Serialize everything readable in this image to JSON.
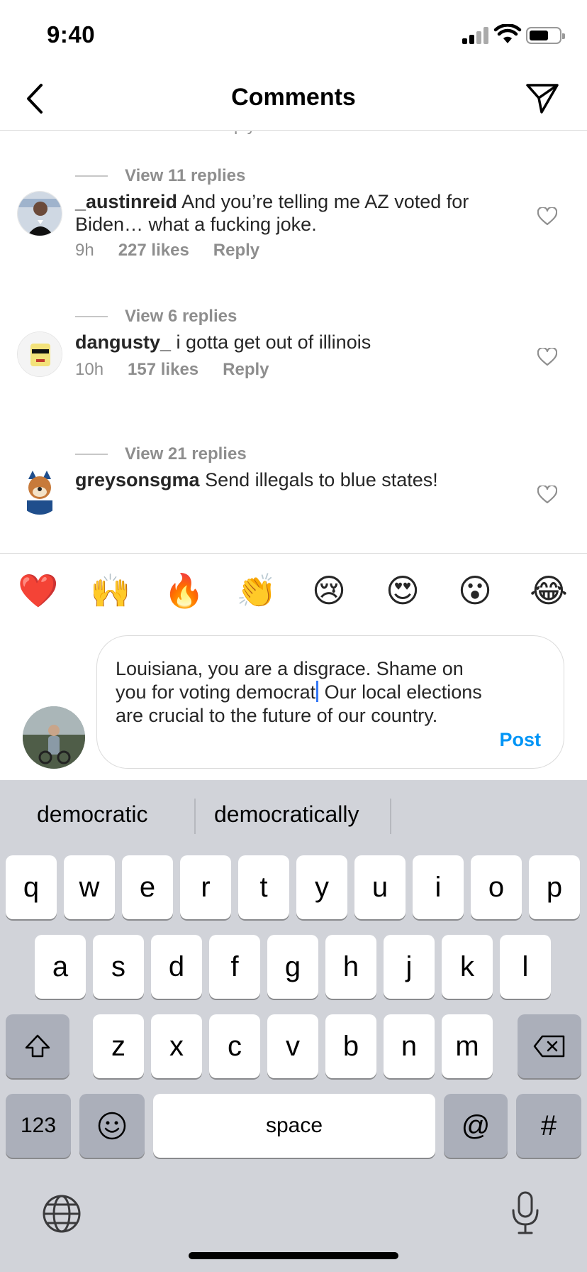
{
  "status_bar": {
    "time": "9:40"
  },
  "header": {
    "title": "Comments"
  },
  "comments": {
    "view_replies": [
      {
        "text": "View 11 replies"
      },
      {
        "text": "View 6 replies"
      },
      {
        "text": "View 21 replies"
      }
    ],
    "items": [
      {
        "username": "_austinreid",
        "text": "And you’re telling me AZ voted for Biden… what a fucking joke.",
        "time": "9h",
        "likes": "227 likes",
        "reply": "Reply"
      },
      {
        "username": "dangusty_",
        "text": "i gotta get out of illinois",
        "time": "10h",
        "likes": "157 likes",
        "reply": "Reply"
      },
      {
        "username": "greysonsgma",
        "text": "Send illegals to blue states!"
      }
    ]
  },
  "emoji_bar": [
    {
      "name": "red-heart",
      "glyph": "❤️"
    },
    {
      "name": "raising-hands",
      "glyph": "🙌"
    },
    {
      "name": "fire",
      "glyph": "🔥"
    },
    {
      "name": "clapping-hands",
      "glyph": "👏"
    },
    {
      "name": "crying-face",
      "glyph": "😢"
    },
    {
      "name": "heart-eyes",
      "glyph": "😍"
    },
    {
      "name": "surprised-face",
      "glyph": "😮"
    },
    {
      "name": "tears-of-joy",
      "glyph": "😂"
    }
  ],
  "composer": {
    "text_before_caret": "Louisiana, you are a disgrace. Shame on you for voting democrat",
    "text_after_caret": " Our local elections are crucial to the future of our country.",
    "post_label": "Post"
  },
  "keyboard": {
    "suggestions": [
      "democratic",
      "democratically"
    ],
    "row1": [
      "q",
      "w",
      "e",
      "r",
      "t",
      "y",
      "u",
      "i",
      "o",
      "p"
    ],
    "row2": [
      "a",
      "s",
      "d",
      "f",
      "g",
      "h",
      "j",
      "k",
      "l"
    ],
    "row3": [
      "z",
      "x",
      "c",
      "v",
      "b",
      "n",
      "m"
    ],
    "numbers_label": "123",
    "space_label": "space",
    "at_label": "@",
    "hash_label": "#"
  },
  "colors": {
    "accent": "#0095f6",
    "caret": "#3478f6",
    "keyboard_bg": "#d1d3d9"
  }
}
